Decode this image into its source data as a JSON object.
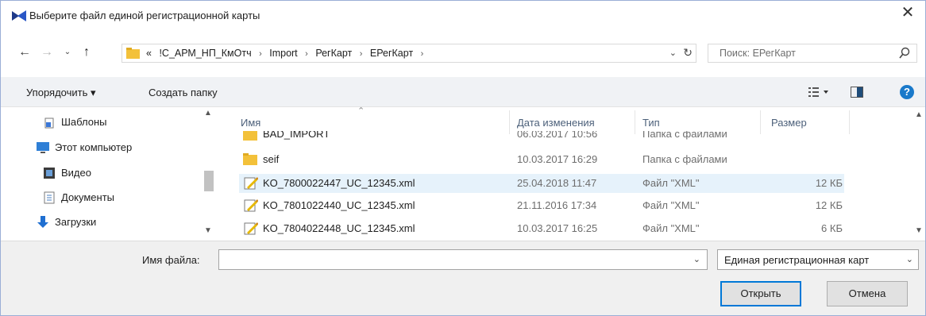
{
  "window": {
    "title": "Выберите файл единой регистрационной карты",
    "close_glyph": "✕"
  },
  "nav": {
    "back_glyph": "←",
    "forward_glyph": "→",
    "recent_glyph": "⌄",
    "up_glyph": "↑",
    "breadcrumbs": [
      "«",
      "!С_АРМ_НП_КмОтч",
      "Import",
      "РегКарт",
      "ЕРегКарт"
    ],
    "breadcrumb_sep": "›",
    "search_placeholder": "Поиск: ЕРегКарт"
  },
  "toolbar": {
    "organize_label": "Упорядочить ▾",
    "new_folder_label": "Создать папку",
    "help_glyph": "?"
  },
  "sidebar": {
    "items": [
      {
        "label": "Шаблоны",
        "icon": "templates-icon"
      },
      {
        "label": "Этот компьютер",
        "icon": "computer-icon"
      },
      {
        "label": "Видео",
        "icon": "video-icon"
      },
      {
        "label": "Документы",
        "icon": "documents-icon"
      },
      {
        "label": "Загрузки",
        "icon": "downloads-icon"
      }
    ]
  },
  "filelist": {
    "columns": {
      "name": "Имя",
      "date": "Дата изменения",
      "type": "Тип",
      "size": "Размер"
    },
    "rows": [
      {
        "name": "BAD_IMPORT",
        "date": "06.03.2017 10:56",
        "type": "Папка с файлами",
        "size": "",
        "icon": "folder-icon"
      },
      {
        "name": "seif",
        "date": "10.03.2017 16:29",
        "type": "Папка с файлами",
        "size": "",
        "icon": "folder-icon"
      },
      {
        "name": "KO_7800022447_UC_12345.xml",
        "date": "25.04.2018 11:47",
        "type": "Файл \"XML\"",
        "size": "12 КБ",
        "icon": "xml-file-icon"
      },
      {
        "name": "KO_7801022440_UC_12345.xml",
        "date": "21.11.2016 17:34",
        "type": "Файл \"XML\"",
        "size": "12 КБ",
        "icon": "xml-file-icon"
      },
      {
        "name": "KO_7804022448_UC_12345.xml",
        "date": "10.03.2017 16:25",
        "type": "Файл \"XML\"",
        "size": "6 КБ",
        "icon": "xml-file-icon"
      }
    ]
  },
  "footer": {
    "filename_label": "Имя файла:",
    "filename_value": "",
    "filter_value": "Единая регистрационная карт",
    "open_label": "Открыть",
    "cancel_label": "Отмена"
  },
  "colors": {
    "accent": "#0078d7",
    "row_highlight": "#e6f2fb",
    "folder": "#f3c13a",
    "help_blue": "#1979ca"
  }
}
